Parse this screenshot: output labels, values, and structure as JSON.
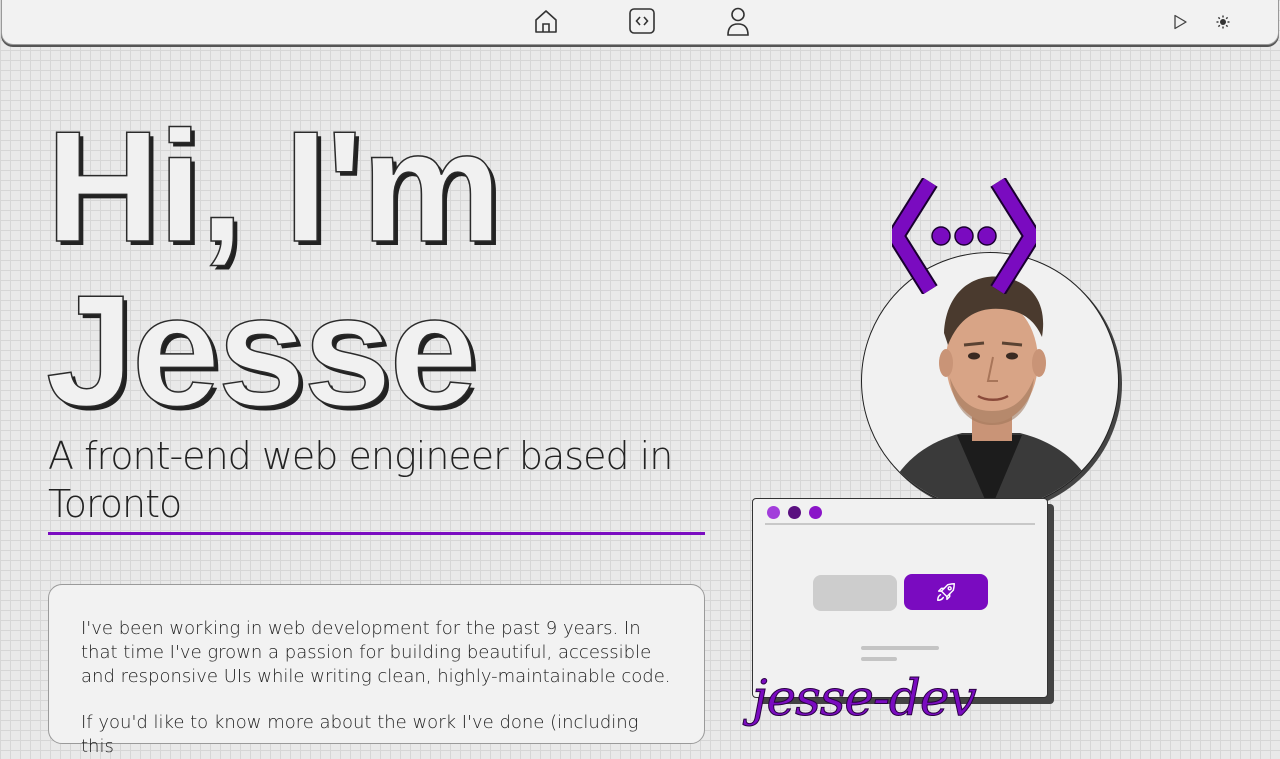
{
  "nav": {
    "icons": [
      "home-icon",
      "code-icon",
      "user-icon",
      "play-icon",
      "sun-icon"
    ]
  },
  "hero": {
    "line1": "Hi, I'm",
    "line2": "Jesse",
    "subtitle": "A front-end web engineer based in Toronto"
  },
  "about": {
    "paragraph1": "I've been working in web development for the past 9 years. In that time I've grown a passion for building beautiful, accessible and responsive UIs while writing clean, highly-maintainable code.",
    "paragraph2": "If you'd like to know more about the work I've done (including this"
  },
  "illustration": {
    "handle": "jesse-dev",
    "icons": [
      "code-logo-icon",
      "rocket-icon"
    ]
  },
  "colors": {
    "accent": "#7a0bc0",
    "dot1": "#a23ddb",
    "dot2": "#5a1080",
    "dot3": "#8a14c8"
  }
}
